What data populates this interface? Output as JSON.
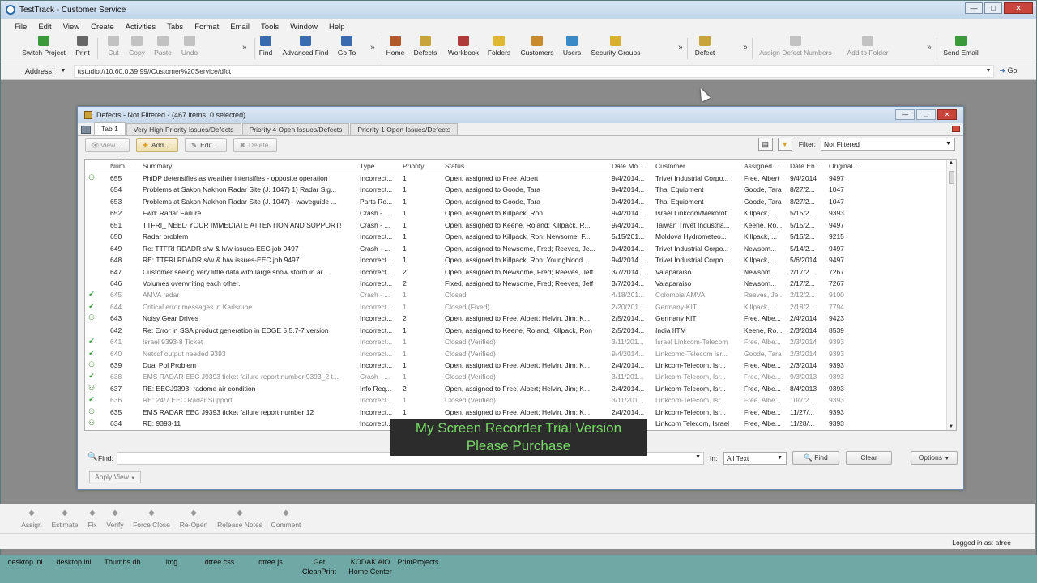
{
  "window": {
    "title": "TestTrack - Customer Service"
  },
  "menu": [
    "File",
    "Edit",
    "View",
    "Create",
    "Activities",
    "Tabs",
    "Format",
    "Email",
    "Tools",
    "Window",
    "Help"
  ],
  "toolbar": [
    {
      "label": "Switch Project",
      "icon": "switch-project-icon",
      "color": "#3a9a3a",
      "disabled": false
    },
    {
      "label": "Print",
      "icon": "print-icon",
      "color": "#666666",
      "disabled": false
    },
    {
      "label": "Cut",
      "icon": "cut-icon",
      "color": "#888888",
      "disabled": true
    },
    {
      "label": "Copy",
      "icon": "copy-icon",
      "color": "#888888",
      "disabled": true
    },
    {
      "label": "Paste",
      "icon": "paste-icon",
      "color": "#888888",
      "disabled": true
    },
    {
      "label": "Undo",
      "icon": "undo-icon",
      "color": "#888888",
      "disabled": true
    },
    {
      "label": "Find",
      "icon": "find-icon",
      "color": "#3a6ab0",
      "disabled": false
    },
    {
      "label": "Advanced Find",
      "icon": "advanced-find-icon",
      "color": "#3a6ab0",
      "disabled": false
    },
    {
      "label": "Go To",
      "icon": "go-to-icon",
      "color": "#3a6ab0",
      "disabled": false
    },
    {
      "label": "Home",
      "icon": "home-icon",
      "color": "#b05a2a",
      "disabled": false
    },
    {
      "label": "Defects",
      "icon": "defects-icon",
      "color": "#c8a43a",
      "disabled": false
    },
    {
      "label": "Workbook",
      "icon": "workbook-icon",
      "color": "#b03a3a",
      "disabled": false
    },
    {
      "label": "Folders",
      "icon": "folders-icon",
      "color": "#e0b830",
      "disabled": false
    },
    {
      "label": "Customers",
      "icon": "customers-icon",
      "color": "#c88a2a",
      "disabled": false
    },
    {
      "label": "Users",
      "icon": "users-icon",
      "color": "#3a8ac8",
      "disabled": false
    },
    {
      "label": "Security Groups",
      "icon": "security-groups-icon",
      "color": "#d8b030",
      "disabled": false
    },
    {
      "label": "Defect",
      "icon": "defect-icon",
      "color": "#c8a43a",
      "disabled": false
    },
    {
      "label": "Assign Defect Numbers",
      "icon": "assign-numbers-icon",
      "color": "#888888",
      "disabled": true
    },
    {
      "label": "Add to Folder",
      "icon": "add-to-folder-icon",
      "color": "#888888",
      "disabled": true
    },
    {
      "label": "Send Email",
      "icon": "send-email-icon",
      "color": "#3a9a3a",
      "disabled": false
    }
  ],
  "address": {
    "label": "Address:",
    "value": "ttstudio://10.60.0.39:99//Customer%20Service/dfct",
    "go": "Go"
  },
  "defects_window": {
    "title": "Defects - Not Filtered - (467 items, 0 selected)",
    "tabs": [
      "Tab 1",
      "Very High Priority Issues/Defects",
      "Priority 4 Open Issues/Defects",
      "Priority 1 Open Issues/Defects"
    ],
    "actions": {
      "view": "View...",
      "add": "Add...",
      "edit": "Edit...",
      "delete": "Delete"
    },
    "filter_label": "Filter:",
    "filter_value": "Not Filtered",
    "columns": [
      "Num...",
      "Summary",
      "Type",
      "Priority",
      "Status",
      "Date Mo...",
      "Customer",
      "Assigned ...",
      "Date En...",
      "Original ..."
    ],
    "rows": [
      {
        "icon": "open",
        "num": "655",
        "summary": "PhiDP detensifies as weather intensifies - opposite operation",
        "type": "Incorrect...",
        "priority": "1",
        "status": "Open, assigned to Free, Albert",
        "date_mod": "9/4/2014...",
        "customer": "Trivet Industrial Corpo...",
        "assigned": "Free, Albert",
        "date_en": "9/4/2014",
        "original": "9497"
      },
      {
        "icon": "",
        "num": "654",
        "summary": "Problems at Sakon Nakhon Radar Site (J. 1047)  1) Radar Sig...",
        "type": "Incorrect...",
        "priority": "1",
        "status": "Open, assigned to Goode, Tara",
        "date_mod": "9/4/2014...",
        "customer": "Thai Equipment",
        "assigned": "Goode, Tara",
        "date_en": "8/27/2...",
        "original": "1047"
      },
      {
        "icon": "",
        "num": "653",
        "summary": "Problems at Sakon Nakhon Radar Site (J. 1047) - waveguide ...",
        "type": "Parts Re...",
        "priority": "1",
        "status": "Open, assigned to Goode, Tara",
        "date_mod": "9/4/2014...",
        "customer": "Thai Equipment",
        "assigned": "Goode, Tara",
        "date_en": "8/27/2...",
        "original": "1047"
      },
      {
        "icon": "",
        "num": "652",
        "summary": "Fwd: Radar Failure",
        "type": "Crash - ...",
        "priority": "1",
        "status": "Open, assigned to Killpack, Ron",
        "date_mod": "9/4/2014...",
        "customer": "Israel Linkcom/Mekorot",
        "assigned": "Killpack, ...",
        "date_en": "5/15/2...",
        "original": "9393"
      },
      {
        "icon": "",
        "num": "651",
        "summary": "TTFRI_ NEED YOUR IMMEDIATE ATTENTION AND SUPPORT!",
        "type": "Crash - ...",
        "priority": "1",
        "status": "Open, assigned to Keene, Roland; Killpack, R...",
        "date_mod": "9/4/2014...",
        "customer": "Taiwan Trivet Industria...",
        "assigned": "Keene, Ro...",
        "date_en": "5/15/2...",
        "original": "9497"
      },
      {
        "icon": "",
        "num": "650",
        "summary": "Radar problem",
        "type": "Incorrect...",
        "priority": "1",
        "status": "Open, assigned to Killpack, Ron; Newsome, F...",
        "date_mod": "5/15/201...",
        "customer": "Moldova Hydrometeo...",
        "assigned": "Killpack, ...",
        "date_en": "5/15/2...",
        "original": "9215"
      },
      {
        "icon": "",
        "num": "649",
        "summary": "Re: TTFRI RDADR s/w & h/w issues-EEC job 9497",
        "type": "Crash - ...",
        "priority": "1",
        "status": "Open, assigned to Newsome, Fred; Reeves, Je...",
        "date_mod": "9/4/2014...",
        "customer": "Trivet Industrial Corpo...",
        "assigned": "Newsom...",
        "date_en": "5/14/2...",
        "original": "9497"
      },
      {
        "icon": "",
        "num": "648",
        "summary": "RE: TTFRI RDADR s/w & h/w issues-EEC job 9497",
        "type": "Incorrect...",
        "priority": "1",
        "status": "Open, assigned to Killpack, Ron; Youngblood...",
        "date_mod": "9/4/2014...",
        "customer": "Trivet Industrial Corpo...",
        "assigned": "Killpack, ...",
        "date_en": "5/6/2014",
        "original": "9497"
      },
      {
        "icon": "",
        "num": "647",
        "summary": "Customer seeing very little data with large snow storm in ar...",
        "type": "Incorrect...",
        "priority": "2",
        "status": "Open, assigned to Newsome, Fred; Reeves, Jeff",
        "date_mod": "3/7/2014...",
        "customer": "Valaparaiso",
        "assigned": "Newsom...",
        "date_en": "2/17/2...",
        "original": "7267"
      },
      {
        "icon": "",
        "num": "646",
        "summary": "Volumes overwriting each other.",
        "type": "Incorrect...",
        "priority": "2",
        "status": "Fixed, assigned to Newsome, Fred; Reeves, Jeff",
        "date_mod": "3/7/2014...",
        "customer": "Valaparaiso",
        "assigned": "Newsom...",
        "date_en": "2/17/2...",
        "original": "7267"
      },
      {
        "icon": "check",
        "num": "645",
        "summary": "AMVA radar",
        "type": "Crash - ...",
        "priority": "1",
        "status": "Closed",
        "date_mod": "4/18/201...",
        "customer": "Colombia AMVA",
        "assigned": "Reeves, Je...",
        "date_en": "2/12/2...",
        "original": "9100",
        "closed": true
      },
      {
        "icon": "check",
        "num": "644",
        "summary": "Critical error messages in Karlsruhe",
        "type": "Incorrect...",
        "priority": "1",
        "status": "Closed (Fixed)",
        "date_mod": "2/20/201...",
        "customer": "Germany-KIT",
        "assigned": "Killpack, ...",
        "date_en": "2/18/2...",
        "original": "7794",
        "closed": true
      },
      {
        "icon": "open",
        "num": "643",
        "summary": "Noisy Gear Drives",
        "type": "Incorrect...",
        "priority": "2",
        "status": "Open, assigned to Free, Albert; Helvin, Jim; K...",
        "date_mod": "2/5/2014...",
        "customer": "Germany KIT",
        "assigned": "Free, Albe...",
        "date_en": "2/4/2014",
        "original": "9423"
      },
      {
        "icon": "",
        "num": "642",
        "summary": "Re: Error in SSA product generation in EDGE 5.5.7-7 version",
        "type": "Incorrect...",
        "priority": "1",
        "status": "Open, assigned to Keene, Roland; Killpack, Ron",
        "date_mod": "2/5/2014...",
        "customer": "India IITM",
        "assigned": "Keene, Ro...",
        "date_en": "2/3/2014",
        "original": "8539"
      },
      {
        "icon": "check",
        "num": "641",
        "summary": "Israel 9393-8 Ticket",
        "type": "Incorrect...",
        "priority": "1",
        "status": "Closed (Verified)",
        "date_mod": "3/11/201...",
        "customer": "Israel Linkcom-Telecom",
        "assigned": "Free, Albe...",
        "date_en": "2/3/2014",
        "original": "9393",
        "closed": true
      },
      {
        "icon": "check",
        "num": "640",
        "summary": "Netcdf output needed 9393",
        "type": "Incorrect...",
        "priority": "1",
        "status": "Closed (Verified)",
        "date_mod": "9/4/2014...",
        "customer": "Linkcomc-Telecom Isr...",
        "assigned": "Goode, Tara",
        "date_en": "2/3/2014",
        "original": "9393",
        "closed": true
      },
      {
        "icon": "open",
        "num": "639",
        "summary": "Dual Pol Problem",
        "type": "Incorrect...",
        "priority": "1",
        "status": "Open, assigned to Free, Albert; Helvin, Jim; K...",
        "date_mod": "2/4/2014...",
        "customer": "Linkcom-Telecom, Isr...",
        "assigned": "Free, Albe...",
        "date_en": "2/3/2014",
        "original": "9393"
      },
      {
        "icon": "check",
        "num": "638",
        "summary": "EMS RADAR EEC J9393 ticket failure report number 9393_2 t...",
        "type": "Crash - ...",
        "priority": "1",
        "status": "Closed (Verified)",
        "date_mod": "3/11/201...",
        "customer": "Linkcom-Telecom, Isr...",
        "assigned": "Free, Albe...",
        "date_en": "9/3/2013",
        "original": "9393",
        "closed": true
      },
      {
        "icon": "open",
        "num": "637",
        "summary": "RE: EECJ9393- radome air condition",
        "type": "Info Req...",
        "priority": "2",
        "status": "Open, assigned to Free, Albert; Helvin, Jim; K...",
        "date_mod": "2/4/2014...",
        "customer": "Linkcom-Telecom, Isr...",
        "assigned": "Free, Albe...",
        "date_en": "8/4/2013",
        "original": "9393"
      },
      {
        "icon": "check",
        "num": "636",
        "summary": "RE: 24/7 EEC Radar Support",
        "type": "Incorrect...",
        "priority": "1",
        "status": "Closed (Verified)",
        "date_mod": "3/11/201...",
        "customer": "Linkcom-Telecom, Isr...",
        "assigned": "Free, Albe...",
        "date_en": "10/7/2...",
        "original": "9393",
        "closed": true
      },
      {
        "icon": "open",
        "num": "635",
        "summary": "EMS RADAR EEC J9393 ticket failure report number 12",
        "type": "Incorrect...",
        "priority": "1",
        "status": "Open, assigned to Free, Albert; Helvin, Jim; K...",
        "date_mod": "2/4/2014...",
        "customer": "Linkcom-Telecom, Isr...",
        "assigned": "Free, Albe...",
        "date_en": "11/27/...",
        "original": "9393"
      },
      {
        "icon": "open",
        "num": "634",
        "summary": "RE: 9393-11",
        "type": "Incorrect...",
        "priority": "",
        "status": "",
        "date_mod": "",
        "customer": "Linkcom Telecom, Israel",
        "assigned": "Free, Albe...",
        "date_en": "11/28/...",
        "original": "9393"
      }
    ],
    "find_label": "Find:",
    "in_label": "In:",
    "in_value": "All Text",
    "find_button": "Find",
    "clear_button": "Clear",
    "options_button": "Options",
    "apply_view": "Apply View"
  },
  "bottom_toolbar": [
    {
      "label": "Assign",
      "icon": "assign-icon"
    },
    {
      "label": "Estimate",
      "icon": "estimate-icon"
    },
    {
      "label": "Fix",
      "icon": "fix-icon"
    },
    {
      "label": "Verify",
      "icon": "verify-icon"
    },
    {
      "label": "Force Close",
      "icon": "force-close-icon"
    },
    {
      "label": "Re-Open",
      "icon": "reopen-icon"
    },
    {
      "label": "Release Notes",
      "icon": "release-notes-icon"
    },
    {
      "label": "Comment",
      "icon": "comment-icon"
    }
  ],
  "status": {
    "logged_in": "Logged in as: afree"
  },
  "desktop_items": [
    "desktop.ini",
    "desktop.ini",
    "Thumbs.db",
    "img",
    "dtree.css",
    "dtree.js",
    "Get\nCleanPrint",
    "KODAK AiO\nHome Center",
    "PrintProjects"
  ],
  "watermark": {
    "line1": "My Screen Recorder Trial Version",
    "line2": "Please Purchase"
  }
}
